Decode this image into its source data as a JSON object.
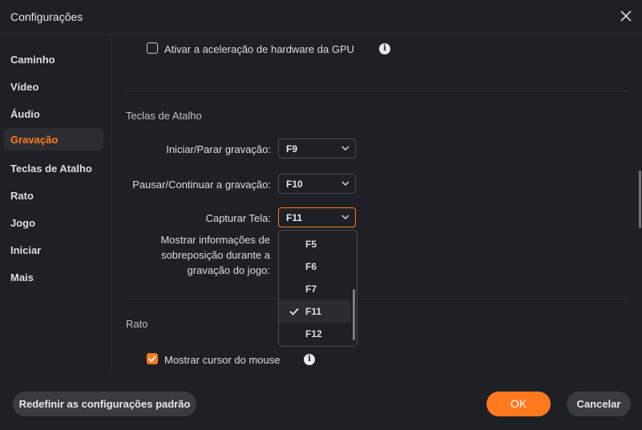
{
  "window": {
    "title": "Configurações"
  },
  "sidebar": {
    "items": [
      {
        "label": "Caminho"
      },
      {
        "label": "Vídeo"
      },
      {
        "label": "Áudio"
      },
      {
        "label": "Gravação",
        "active": true
      },
      {
        "label": "Teclas de Atalho"
      },
      {
        "label": "Rato"
      },
      {
        "label": "Jogo"
      },
      {
        "label": "Iniciar"
      },
      {
        "label": "Mais"
      }
    ]
  },
  "content": {
    "gpu": {
      "label": "Ativar a aceleração de hardware da GPU",
      "checked": false,
      "info_icon": "info-icon"
    },
    "hotkeys": {
      "title": "Teclas de Atalho",
      "start_stop": {
        "label": "Iniciar/Parar gravação:",
        "value": "F9"
      },
      "pause_resume": {
        "label": "Pausar/Continuar  a gravação:",
        "value": "F10"
      },
      "capture": {
        "label": "Capturar Tela:",
        "value": "F11"
      },
      "overlay": {
        "label_lines": [
          "Mostrar informações de",
          "sobreposição durante a",
          "gravação do jogo:"
        ]
      },
      "dropdown_options": [
        "F5",
        "F6",
        "F7",
        "F11",
        "F12"
      ],
      "dropdown_selected": "F11"
    },
    "mouse": {
      "title": "Rato",
      "show_cursor": {
        "label": "Mostrar cursor do mouse",
        "checked": true
      }
    }
  },
  "footer": {
    "reset_label": "Redefinir as configurações padrão",
    "ok_label": "OK",
    "cancel_label": "Cancelar"
  },
  "colors": {
    "accent": "#ff7a1f",
    "background": "#1f2025"
  }
}
